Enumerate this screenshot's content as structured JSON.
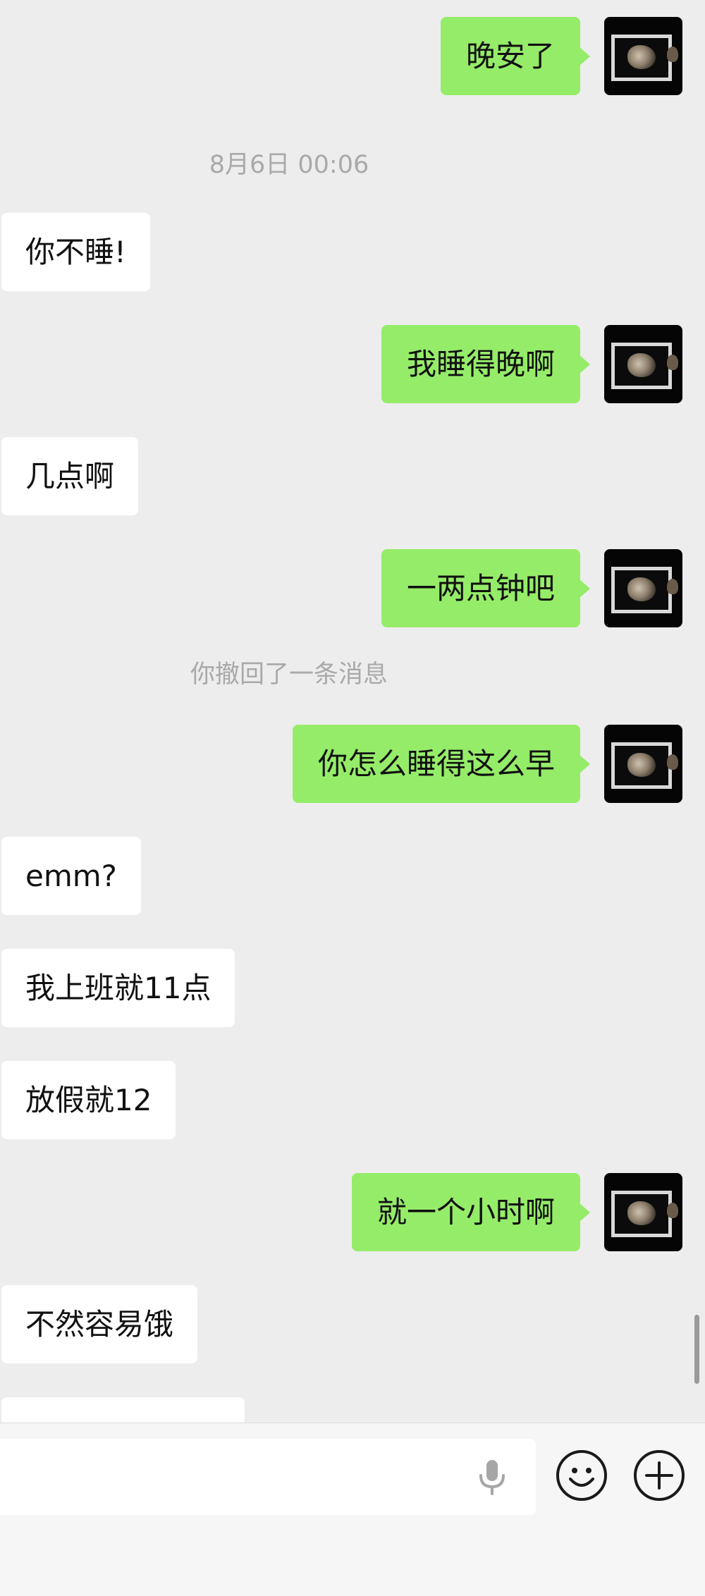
{
  "messages": [
    {
      "side": "sent",
      "text": "晚安了"
    },
    {
      "side": "time",
      "text": "8月6日 00:06"
    },
    {
      "side": "recv",
      "text": "你不睡!"
    },
    {
      "side": "sent",
      "text": "我睡得晚啊"
    },
    {
      "side": "recv",
      "text": "几点啊"
    },
    {
      "side": "sent",
      "text": "一两点钟吧"
    },
    {
      "side": "system",
      "text": "你撤回了一条消息"
    },
    {
      "side": "sent",
      "text": "你怎么睡得这么早"
    },
    {
      "side": "recv",
      "text": "emm?"
    },
    {
      "side": "recv",
      "text": "我上班就11点"
    },
    {
      "side": "recv",
      "text": "放假就12"
    },
    {
      "side": "sent",
      "text": "就一个小时啊"
    },
    {
      "side": "recv",
      "text": "不然容易饿"
    }
  ],
  "input_bar": {
    "voice_icon": "microphone-icon",
    "emoji_icon": "smiley-icon",
    "more_icon": "plus-icon"
  },
  "colors": {
    "sent_bubble": "#95ec69",
    "recv_bubble": "#ffffff",
    "background": "#ededed"
  }
}
